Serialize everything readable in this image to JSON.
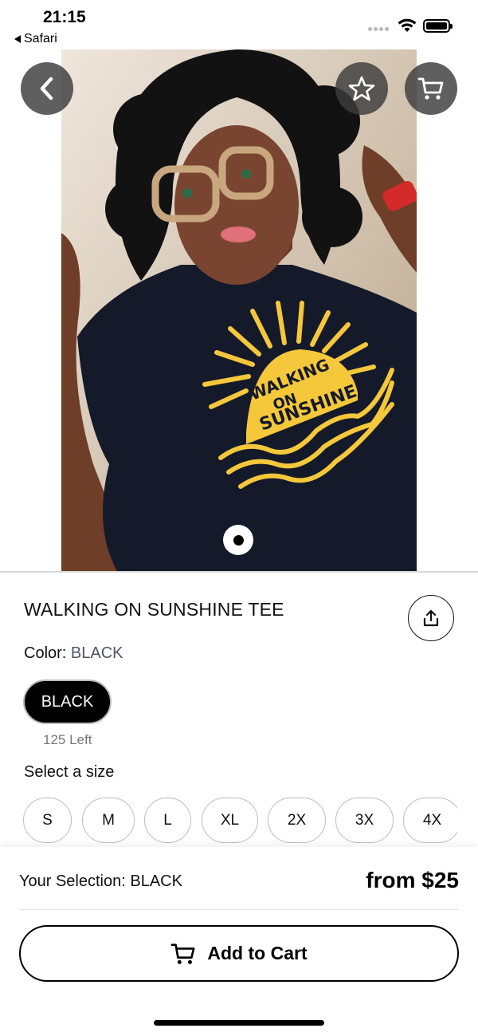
{
  "status_bar": {
    "time": "21:15",
    "back_app": "Safari",
    "wifi_icon": "wifi-icon",
    "battery_icon": "battery-icon"
  },
  "hero": {
    "back_icon": "chevron-left-icon",
    "favorite_icon": "star-icon",
    "cart_icon": "cart-icon",
    "pager_icon": "page-indicator-dot"
  },
  "product": {
    "title": "WALKING ON SUNSHINE TEE",
    "share_icon": "share-icon",
    "color_label": "Color:",
    "color_value": "BLACK",
    "color_options": [
      "BLACK"
    ],
    "stock": "125 Left",
    "size_heading": "Select a size",
    "sizes": [
      "S",
      "M",
      "L",
      "XL",
      "2X",
      "3X",
      "4X"
    ]
  },
  "bottom_bar": {
    "selection_label": "Your Selection: BLACK",
    "price": "from $25",
    "add_to_cart": "Add to Cart",
    "cart_icon": "cart-icon"
  },
  "colors": {
    "button_overlay": "#3c3c3c",
    "selected_pill": "#000000",
    "shirt": "#141a2a",
    "print_yellow": "#f5c73a"
  }
}
